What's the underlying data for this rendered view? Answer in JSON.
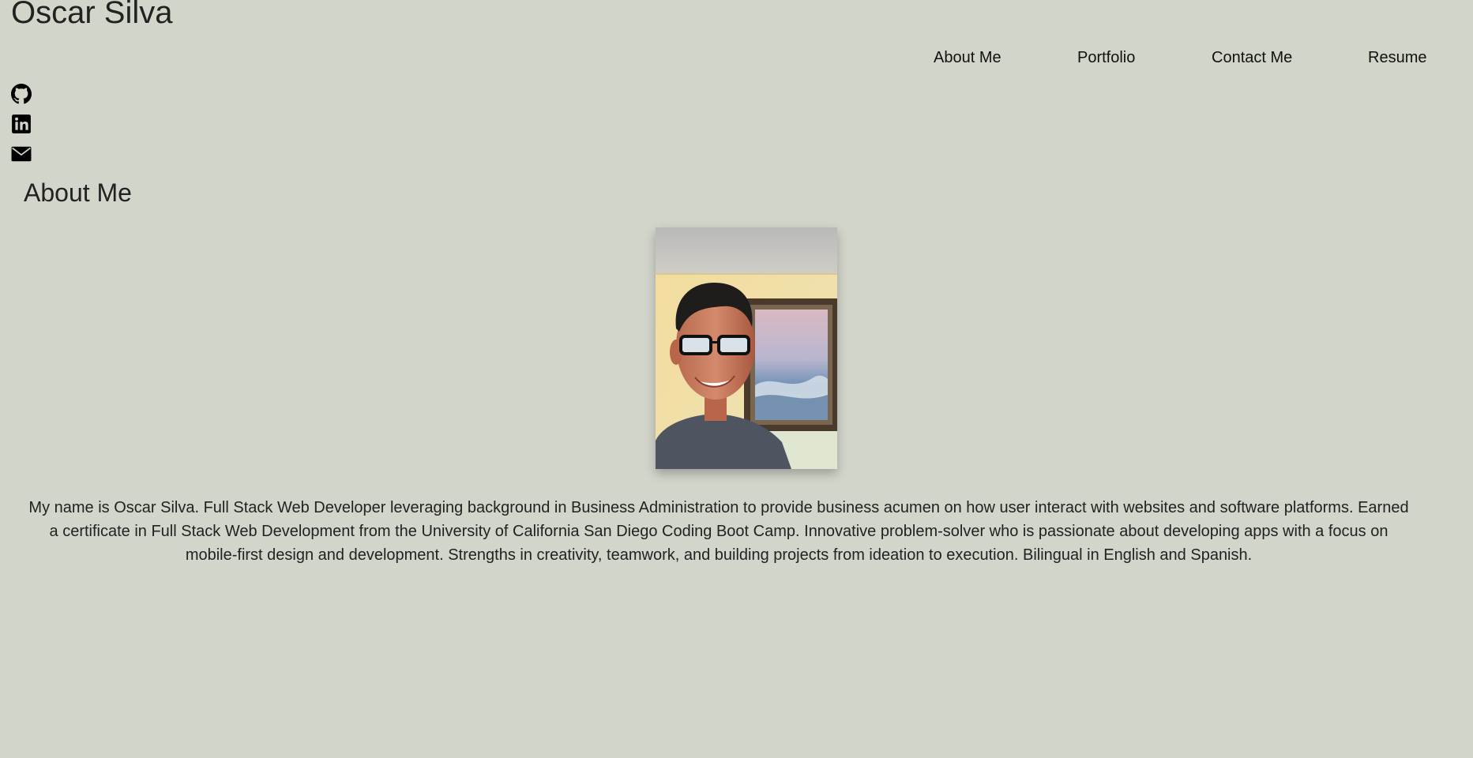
{
  "header": {
    "site_name": "Oscar Silva"
  },
  "nav": {
    "items": [
      {
        "label": "About Me"
      },
      {
        "label": "Portfolio"
      },
      {
        "label": "Contact Me"
      },
      {
        "label": "Resume"
      }
    ]
  },
  "social": {
    "icons": [
      "github-icon",
      "linkedin-icon",
      "envelope-icon"
    ]
  },
  "about": {
    "title": "About Me",
    "bio": "My name is Oscar Silva. Full Stack Web Developer leveraging background in Business Administration to provide business acumen on how user interact with websites and software platforms. Earned a certificate in Full Stack Web Development from the University of California San Diego Coding Boot Camp. Innovative problem-solver who is passionate about developing apps with a focus on mobile-first design and development. Strengths in creativity, teamwork, and building projects from ideation to execution. Bilingual in English and Spanish."
  },
  "colors": {
    "background": "#d2d5ca",
    "text": "#222222",
    "link": "#111111"
  }
}
